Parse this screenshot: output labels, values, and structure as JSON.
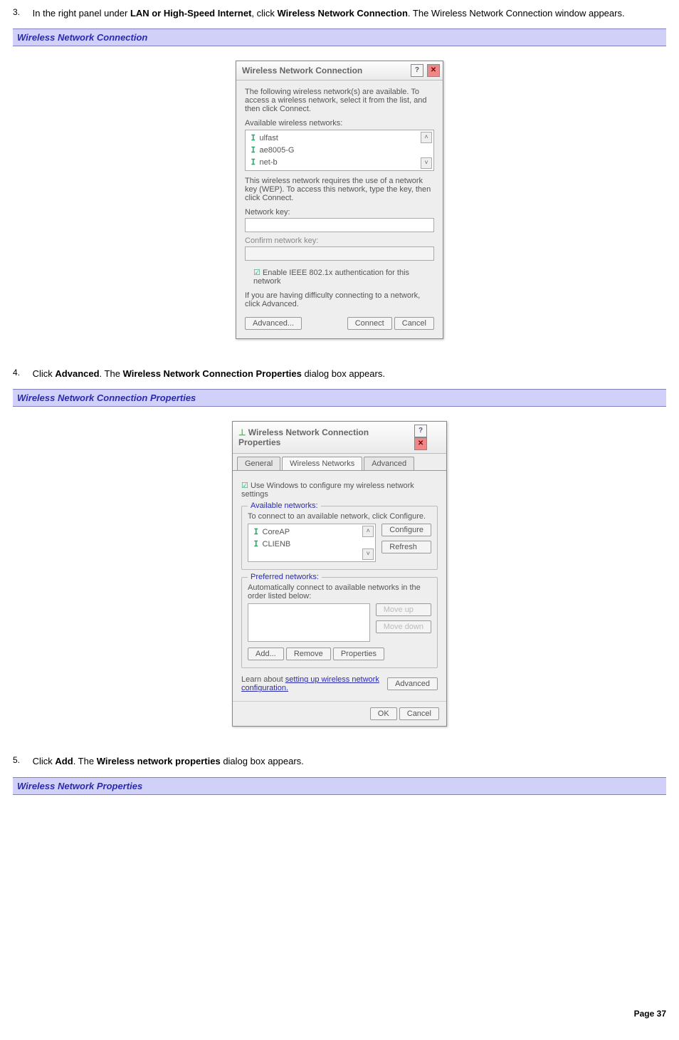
{
  "steps": {
    "s3": {
      "num": "3.",
      "pre": "In the right panel under ",
      "b1": "LAN or High-Speed Internet",
      "mid": ", click ",
      "b2": "Wireless Network Connection",
      "post": ". The Wireless Network Connection window appears."
    },
    "s4": {
      "num": "4.",
      "pre": "Click ",
      "b1": "Advanced",
      "mid": ". The ",
      "b2": "Wireless Network Connection Properties",
      "post": " dialog box appears."
    },
    "s5": {
      "num": "5.",
      "pre": "Click ",
      "b1": "Add",
      "mid": ". The ",
      "b2": "Wireless network properties",
      "post": " dialog box appears."
    }
  },
  "headings": {
    "h1": "Wireless Network Connection",
    "h2": "Wireless Network Connection Properties",
    "h3": "Wireless Network Properties"
  },
  "dlg1": {
    "title": "Wireless Network Connection",
    "intro": "The following wireless network(s) are available. To access a wireless network, select it from the list, and then click Connect.",
    "avail_label": "Available wireless networks:",
    "networks": [
      "ulfast",
      "ae8005-G",
      "net-b"
    ],
    "wep_note": "This wireless network requires the use of a network key (WEP). To access this network, type the key, then click Connect.",
    "key_label": "Network key:",
    "confirm_label": "Confirm network key:",
    "chk_label": "Enable IEEE 802.1x authentication for this network",
    "difficulty": "If you are having difficulty connecting to a network, click Advanced.",
    "btn_advanced": "Advanced...",
    "btn_connect": "Connect",
    "btn_cancel": "Cancel"
  },
  "dlg2": {
    "title": "Wireless Network Connection Properties",
    "tabs": [
      "General",
      "Wireless Networks",
      "Advanced"
    ],
    "use_windows": "Use Windows to configure my wireless network settings",
    "grp_avail": "Available networks:",
    "avail_hint": "To connect to an available network, click Configure.",
    "avail_items": [
      "CoreAP",
      "CLIENB"
    ],
    "btn_configure": "Configure",
    "btn_refresh": "Refresh",
    "grp_pref": "Preferred networks:",
    "pref_hint": "Automatically connect to available networks in the order listed below:",
    "btn_moveup": "Move up",
    "btn_movedown": "Move down",
    "btn_add": "Add...",
    "btn_remove": "Remove",
    "btn_props": "Properties",
    "learn_pre": "Learn about ",
    "learn_link": "setting up wireless network configuration.",
    "btn_adv": "Advanced",
    "btn_ok": "OK",
    "btn_cancel": "Cancel"
  },
  "footer": "Page 37",
  "glyphs": {
    "help": "?",
    "close": "✕",
    "up": "˄",
    "down": "˅",
    "check": "☑"
  }
}
